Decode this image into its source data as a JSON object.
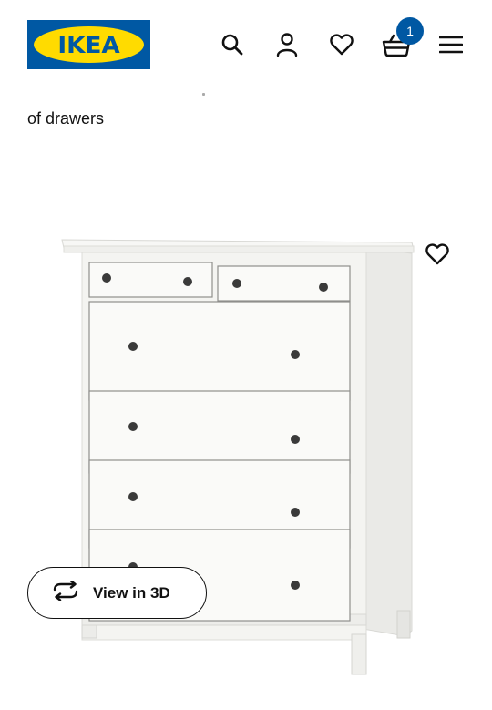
{
  "header": {
    "logo_text": "IKEA",
    "icons": {
      "search": "search-icon",
      "account": "person-icon",
      "favourites": "heart-icon",
      "cart": "basket-icon",
      "menu": "hamburger-menu-icon"
    },
    "cart_count": "1"
  },
  "product": {
    "title_fragment": "of drawers",
    "image_name": "dresser-product-image",
    "favourite_icon": "heart-outline-icon",
    "view_3d_label": "View in 3D",
    "view_3d_icon": "rotate-3d-icon"
  },
  "colors": {
    "brand_blue": "#0058a3",
    "brand_yellow": "#ffdb00",
    "text": "#111111",
    "background": "#ffffff"
  }
}
